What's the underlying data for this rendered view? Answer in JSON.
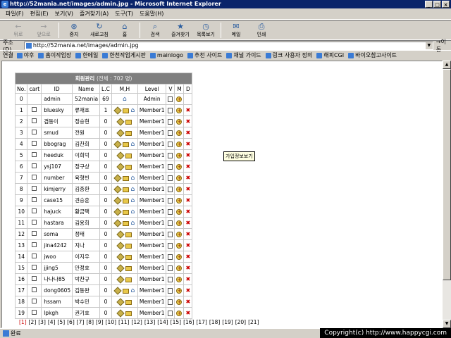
{
  "window": {
    "title": "http://52mania.net/images/admin.jpg - Microsoft Internet Explorer"
  },
  "menu": [
    "파일(F)",
    "편집(E)",
    "보기(V)",
    "즐겨찾기(A)",
    "도구(T)",
    "도움말(H)"
  ],
  "toolbar": [
    {
      "label": "뒤로",
      "icon": "back-arrow-icon",
      "disabled": true
    },
    {
      "label": "앞으로",
      "icon": "forward-arrow-icon",
      "disabled": true
    },
    {
      "label": "중지",
      "icon": "stop-icon",
      "disabled": false
    },
    {
      "label": "새로고침",
      "icon": "refresh-icon",
      "disabled": false
    },
    {
      "label": "홈",
      "icon": "home-icon",
      "disabled": false
    },
    {
      "label": "검색",
      "icon": "search-icon",
      "disabled": false
    },
    {
      "label": "즐겨찾기",
      "icon": "favorites-icon",
      "disabled": false
    },
    {
      "label": "목록보기",
      "icon": "history-icon",
      "disabled": false
    },
    {
      "label": "메일",
      "icon": "mail-icon",
      "disabled": false
    },
    {
      "label": "인쇄",
      "icon": "print-icon",
      "disabled": false
    }
  ],
  "address": {
    "label": "주소(D)",
    "value": "http://52mania.net/images/admin.jpg",
    "go": "이동"
  },
  "links": {
    "label": "연결",
    "items": [
      "야후",
      "홈이작업장",
      "한메일",
      "한천작업게시판",
      "mainlogo",
      "추천 사이트",
      "채널 가이드",
      "링크 사용자 정의",
      "해피CGI",
      "바이오참고사이트"
    ]
  },
  "table": {
    "title": "회원관리",
    "total": "(전체 : 702 명)",
    "columns": [
      "No.",
      "cart",
      "ID",
      "Name",
      "L.C",
      "M,H",
      "Level",
      "V",
      "M",
      "D"
    ],
    "rows": [
      {
        "no": "0",
        "cart": false,
        "id": "admin",
        "name": "52mania",
        "lc": "69",
        "icons": "h",
        "level": "Admin",
        "d": false
      },
      {
        "no": "1",
        "cart": true,
        "id": "bluesky",
        "name": "류재호",
        "lc": "1",
        "icons": "gmh",
        "level": "Member1",
        "d": true
      },
      {
        "no": "2",
        "cart": true,
        "id": "겸동이",
        "name": "정승현",
        "lc": "0",
        "icons": "gm",
        "level": "Member1",
        "d": true
      },
      {
        "no": "3",
        "cart": true,
        "id": "smud",
        "name": "전원",
        "lc": "0",
        "icons": "gm",
        "level": "Member1",
        "d": true
      },
      {
        "no": "4",
        "cart": true,
        "id": "bbograg",
        "name": "김찬희",
        "lc": "0",
        "icons": "gmh",
        "level": "Member1",
        "d": true
      },
      {
        "no": "5",
        "cart": true,
        "id": "heeduk",
        "name": "이희덕",
        "lc": "0",
        "icons": "gm",
        "level": "Member1",
        "d": true
      },
      {
        "no": "6",
        "cart": true,
        "id": "ysj107",
        "name": "정구상",
        "lc": "0",
        "icons": "gm",
        "level": "Member1",
        "d": true
      },
      {
        "no": "7",
        "cart": true,
        "id": "number",
        "name": "육형빈",
        "lc": "0",
        "icons": "gmh",
        "level": "Member1",
        "d": true
      },
      {
        "no": "8",
        "cart": true,
        "id": "kimjerry",
        "name": "김종환",
        "lc": "0",
        "icons": "gmh",
        "level": "Member1",
        "d": true
      },
      {
        "no": "9",
        "cart": true,
        "id": "case15",
        "name": "견승훈",
        "lc": "0",
        "icons": "gmh",
        "level": "Member1",
        "d": true
      },
      {
        "no": "10",
        "cart": true,
        "id": "hajuck",
        "name": "황금택",
        "lc": "0",
        "icons": "gmh",
        "level": "Member1",
        "d": true
      },
      {
        "no": "11",
        "cart": true,
        "id": "hastara",
        "name": "김용희",
        "lc": "0",
        "icons": "gmh",
        "level": "Member1",
        "d": true
      },
      {
        "no": "12",
        "cart": true,
        "id": "soma",
        "name": "정태",
        "lc": "0",
        "icons": "gm",
        "level": "Member1",
        "d": true
      },
      {
        "no": "13",
        "cart": true,
        "id": "jina4242",
        "name": "지나",
        "lc": "0",
        "icons": "gm",
        "level": "Member1",
        "d": true
      },
      {
        "no": "14",
        "cart": true,
        "id": "jwoo",
        "name": "이지우",
        "lc": "0",
        "icons": "gm",
        "level": "Member1",
        "d": true
      },
      {
        "no": "15",
        "cart": true,
        "id": "jjing5",
        "name": "안정호",
        "lc": "0",
        "icons": "gm",
        "level": "Member1",
        "d": true
      },
      {
        "no": "16",
        "cart": true,
        "id": "나나나85",
        "name": "박찬규",
        "lc": "0",
        "icons": "gm",
        "level": "Member1",
        "d": true
      },
      {
        "no": "17",
        "cart": true,
        "id": "dong0605",
        "name": "김동완",
        "lc": "0",
        "icons": "gmh",
        "level": "Member1",
        "d": true
      },
      {
        "no": "18",
        "cart": true,
        "id": "hssam",
        "name": "박수민",
        "lc": "0",
        "icons": "gm",
        "level": "Member1",
        "d": true
      },
      {
        "no": "19",
        "cart": true,
        "id": "lpkgh",
        "name": "권기호",
        "lc": "0",
        "icons": "gm",
        "level": "Member1",
        "d": true
      }
    ]
  },
  "tooltip": "가입정보보기",
  "pages": [
    "[1]",
    "[2]",
    "[3]",
    "[4]",
    "[5]",
    "[6]",
    "[7]",
    "[8]",
    "[9]",
    "[10]",
    "[11]",
    "[12]",
    "[13]",
    "[14]",
    "[15]",
    "[16]",
    "[17]",
    "[18]",
    "[19]",
    "[20]",
    "[21]"
  ],
  "status": {
    "text": "완료"
  },
  "copyright": "Copyright(c) http://www.happycgi.com"
}
